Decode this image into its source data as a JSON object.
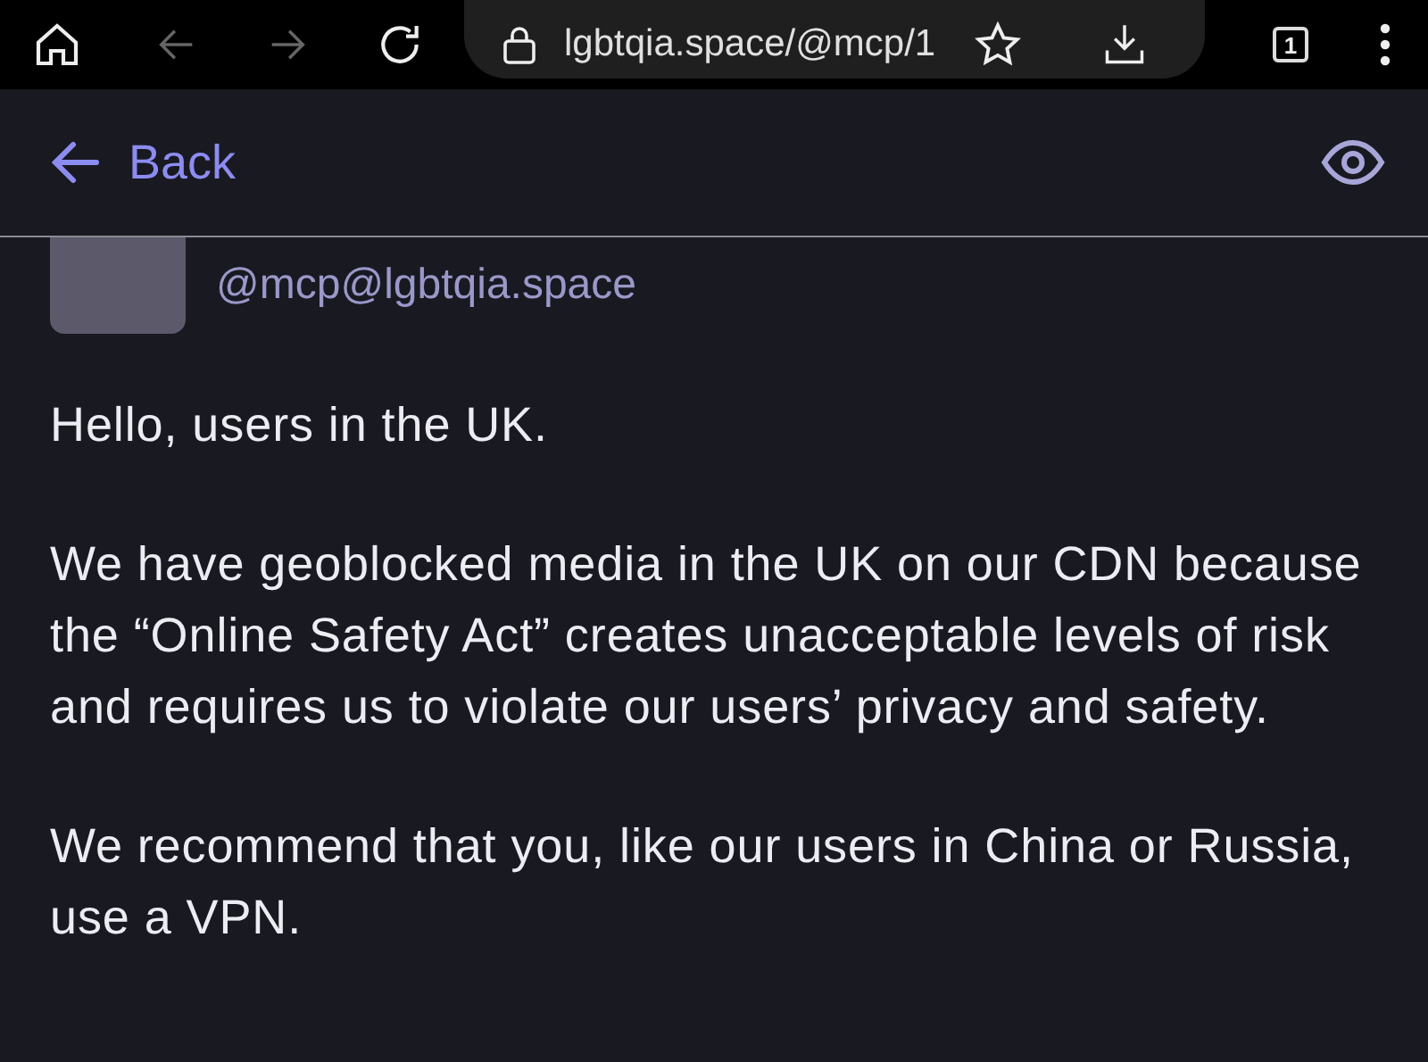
{
  "browser": {
    "url": "lgbtqia.space/@mcp/1",
    "tab_count": "1"
  },
  "header": {
    "back_label": "Back"
  },
  "account": {
    "handle": "@mcp@lgbtqia.space"
  },
  "post": {
    "paragraphs": [
      "Hello, users in the UK.",
      "We have geoblocked media in the UK on our CDN because the “Online Safety Act” creates unacceptable levels of risk and requires us to violate our users’ privacy and safety.",
      "We recommend that you, like our users in China or Russia, use a VPN."
    ]
  }
}
